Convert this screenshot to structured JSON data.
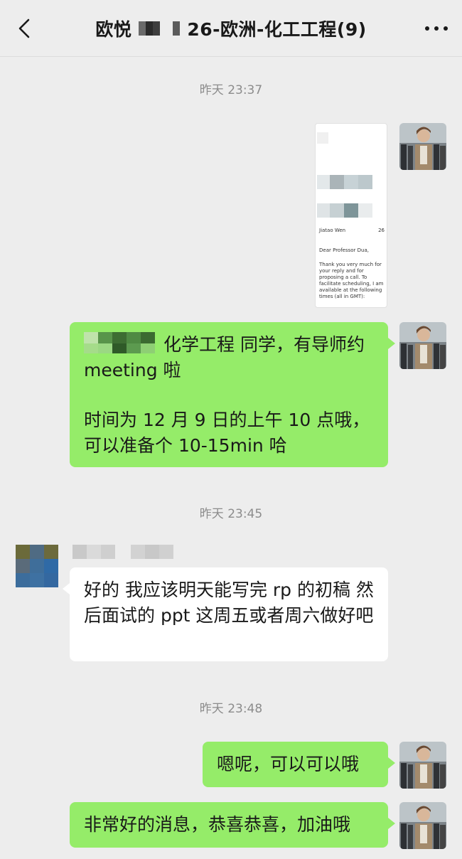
{
  "header": {
    "title_prefix": "欧悦",
    "title_suffix": "26-欧洲-化工工程(9)",
    "back_icon": "chevron-left-icon",
    "more_icon": "more-dots-icon"
  },
  "messages": {
    "ts1": "昨天 23:37",
    "doc_name": "Jiatao Wen",
    "doc_num": "26",
    "doc_greeting": "Dear Professor Dua,",
    "doc_body": "Thank you very much for your reply and for proposing a call. To facilitate scheduling, I am available at the following times (all in GMT):",
    "msg1_after_mosaic": "化学工程  同学，有导师约 meeting 啦",
    "msg1_line2": "时间为 12 月 9 日的上午 10 点哦，可以准备个 10-15min 哈",
    "ts2": "昨天 23:45",
    "msg2": "好的 我应该明天能写完 rp 的初稿 然后面试的 ppt 这周五或者周六做好吧",
    "ts3": "昨天 23:48",
    "msg3": "嗯呢，可以可以哦",
    "msg4": "非常好的消息，恭喜恭喜，加油哦"
  },
  "colors": {
    "bg": "#ededed",
    "green_bubble": "#95ec69",
    "white_bubble": "#ffffff",
    "timestamp": "#8c8c8c"
  }
}
